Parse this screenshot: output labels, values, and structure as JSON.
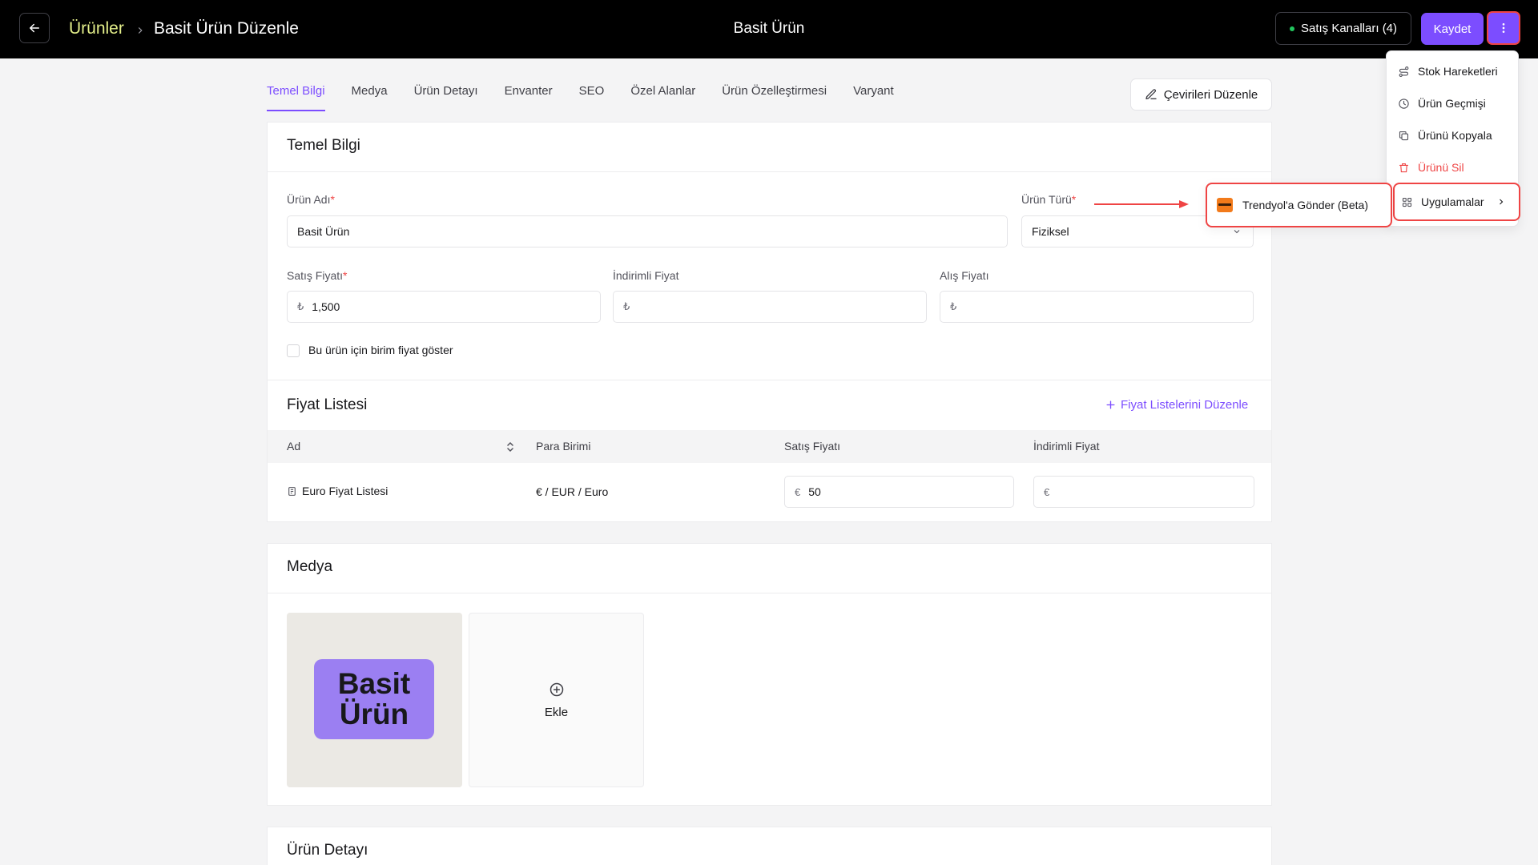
{
  "header": {
    "breadcrumb_parent": "Ürünler",
    "breadcrumb_current": "Basit Ürün Düzenle",
    "page_title": "Basit Ürün",
    "channels_label": "Satış Kanalları (4)",
    "save_label": "Kaydet"
  },
  "tabs": [
    {
      "label": "Temel Bilgi",
      "active": true
    },
    {
      "label": "Medya"
    },
    {
      "label": "Ürün Detayı"
    },
    {
      "label": "Envanter"
    },
    {
      "label": "SEO"
    },
    {
      "label": "Özel Alanlar"
    },
    {
      "label": "Ürün Özelleştirmesi"
    },
    {
      "label": "Varyant"
    }
  ],
  "translate_button": "Çevirileri Düzenle",
  "basic_info": {
    "title": "Temel Bilgi",
    "name_label": "Ürün Adı",
    "name_value": "Basit Ürün",
    "type_label": "Ürün Türü",
    "type_value": "Fiziksel",
    "required_mark": "*",
    "sale_price_label": "Satış Fiyatı",
    "sale_price_currency": "₺",
    "sale_price_value": "1,500",
    "discount_price_label": "İndirimli Fiyat",
    "discount_price_currency": "₺",
    "purchase_price_label": "Alış Fiyatı",
    "purchase_price_currency": "₺",
    "unit_price_checkbox": "Bu ürün için birim fiyat göster"
  },
  "price_list": {
    "title": "Fiyat Listesi",
    "edit_link": "Fiyat Listelerini Düzenle",
    "columns": [
      "Ad",
      "Para Birimi",
      "Satış Fiyatı",
      "İndirimli Fiyat"
    ],
    "rows": [
      {
        "name": "Euro Fiyat Listesi",
        "currency": "€ / EUR / Euro",
        "sale_symbol": "€",
        "sale_value": "50",
        "discount_symbol": "€"
      }
    ]
  },
  "media": {
    "title": "Medya",
    "image_text_line1": "Basit",
    "image_text_line2": "Ürün",
    "add_label": "Ekle"
  },
  "product_detail": {
    "title": "Ürün Detayı"
  },
  "more_menu": {
    "items": [
      {
        "label": "Stok Hareketleri",
        "icon": "route-icon"
      },
      {
        "label": "Ürün Geçmişi",
        "icon": "history-icon"
      },
      {
        "label": "Ürünü Kopyala",
        "icon": "copy-icon"
      },
      {
        "label": "Ürünü Sil",
        "icon": "trash-icon",
        "danger": true
      }
    ],
    "apps_label": "Uygulamalar",
    "submenu_item": "Trendyol'a Gönder (Beta)"
  },
  "colors": {
    "accent": "#7c4dff",
    "danger": "#ef4444",
    "breadcrumb": "#e4ef8a",
    "online": "#22c55e"
  }
}
